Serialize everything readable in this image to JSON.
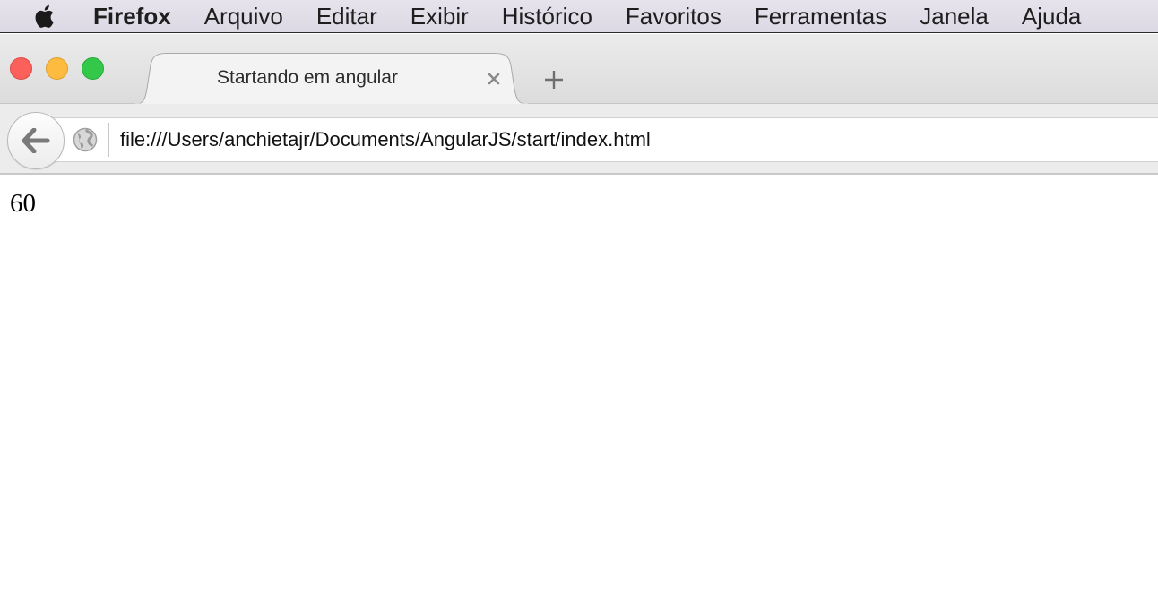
{
  "menubar": {
    "apple_icon": "apple-logo-icon",
    "app_name": "Firefox",
    "items": [
      "Arquivo",
      "Editar",
      "Exibir",
      "Histórico",
      "Favoritos",
      "Ferramentas",
      "Janela",
      "Ajuda"
    ]
  },
  "window": {
    "traffic_lights": {
      "close_color": "#fc605b",
      "minimize_color": "#fdbc40",
      "maximize_color": "#34c84a"
    }
  },
  "tabs": [
    {
      "title": "Startando em angular",
      "close_icon": "close-icon",
      "active": true
    }
  ],
  "new_tab_icon": "plus-icon",
  "navbar": {
    "back_icon": "back-arrow-icon",
    "site_icon": "globe-icon",
    "url": "file:///Users/anchietajr/Documents/AngularJS/start/index.html"
  },
  "page": {
    "text": "60"
  }
}
